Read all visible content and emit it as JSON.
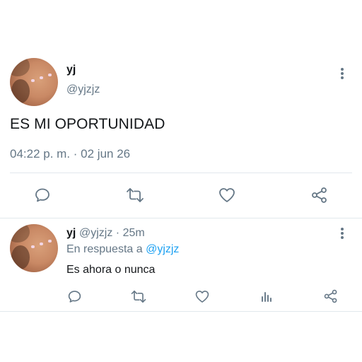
{
  "main_tweet": {
    "name": "yj",
    "handle": "@yjzjz",
    "text": "ES MI OPORTUNIDAD",
    "timestamp": "04:22 p. m. · 02 jun 26",
    "actions": [
      "reply-icon",
      "retweet-icon",
      "like-icon",
      "share-icon"
    ]
  },
  "reply_tweet": {
    "name": "yj",
    "handle_time": "@yjzjz · 25m",
    "replying_prefix": "En respuesta a",
    "replying_to": "@yjzjz",
    "text": "Es ahora o nunca",
    "actions": [
      "reply-icon",
      "retweet-icon",
      "like-icon",
      "analytics-icon",
      "share-icon"
    ]
  },
  "colors": {
    "text": "#14171a",
    "secondary": "#657786",
    "link": "#1da1f2",
    "divider": "#e1e8ed"
  }
}
